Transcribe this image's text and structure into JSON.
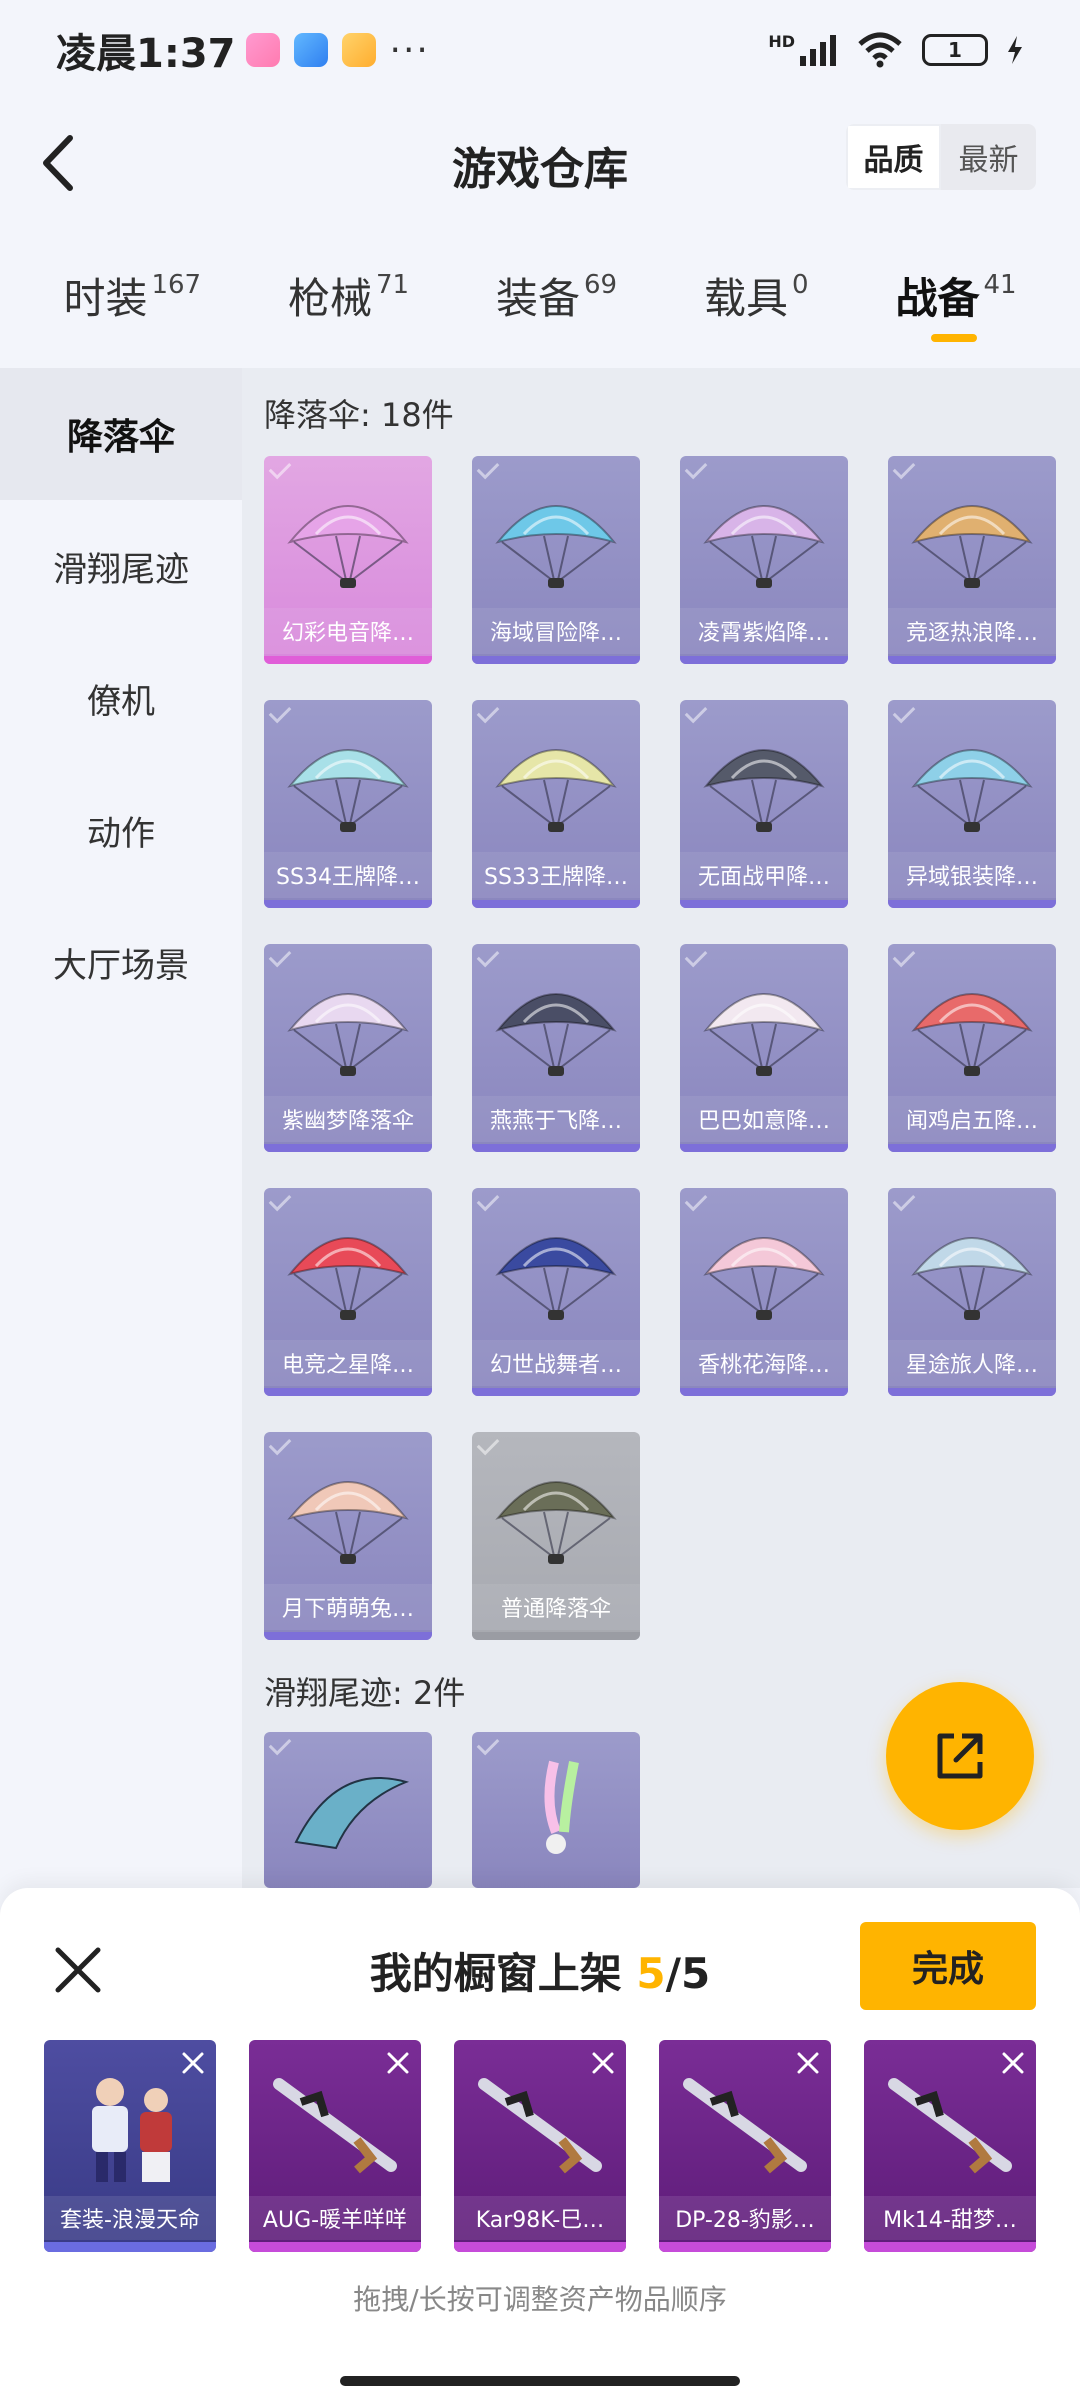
{
  "status": {
    "time": "凌晨1:37",
    "hd": "HD",
    "battery": "1"
  },
  "header": {
    "title": "游戏仓库",
    "sort_options": [
      "品质",
      "最新"
    ]
  },
  "tabs": [
    {
      "label": "时装",
      "count": "167"
    },
    {
      "label": "枪械",
      "count": "71"
    },
    {
      "label": "装备",
      "count": "69"
    },
    {
      "label": "载具",
      "count": "0"
    },
    {
      "label": "战备",
      "count": "41"
    }
  ],
  "sidebar": {
    "items": [
      "降落伞",
      "滑翔尾迹",
      "僚机",
      "动作",
      "大厅场景"
    ]
  },
  "sections": {
    "parachute": {
      "title": "降落伞: 18件"
    },
    "trail": {
      "title": "滑翔尾迹: 2件"
    }
  },
  "items": [
    {
      "name": "幻彩电音降…",
      "color": "#e6a4e8"
    },
    {
      "name": "海域冒险降…",
      "color": "#6ec8e8"
    },
    {
      "name": "凌霄紫焰降…",
      "color": "#d8b4e8"
    },
    {
      "name": "竞逐热浪降…",
      "color": "#e0b070"
    },
    {
      "name": "SS34王牌降…",
      "color": "#a8e0e8"
    },
    {
      "name": "SS33王牌降…",
      "color": "#e6e6a8"
    },
    {
      "name": "无面战甲降…",
      "color": "#555a6a"
    },
    {
      "name": "异域银装降…",
      "color": "#8ed0e8"
    },
    {
      "name": "紫幽梦降落伞",
      "color": "#e8d8f0"
    },
    {
      "name": "燕燕于飞降…",
      "color": "#4a4e66"
    },
    {
      "name": "巴巴如意降…",
      "color": "#f2e8f0"
    },
    {
      "name": "闻鸡启五降…",
      "color": "#e86a6a"
    },
    {
      "name": "电竞之星降…",
      "color": "#e84a58"
    },
    {
      "name": "幻世战舞者…",
      "color": "#3a4aa0"
    },
    {
      "name": "香桃花海降…",
      "color": "#f4c8d8"
    },
    {
      "name": "星途旅人降…",
      "color": "#c0d8e8"
    },
    {
      "name": "月下萌萌兔…",
      "color": "#f0c8b8"
    },
    {
      "name": "普通降落伞",
      "color": "#6a6e58"
    }
  ],
  "trail_items": [
    {
      "color": "#6ab0c8"
    },
    {
      "color": "#f0f0f0"
    }
  ],
  "showcase": {
    "title": "我的橱窗上架",
    "current": "5",
    "total": "/5",
    "done": "完成",
    "hint": "拖拽/长按可调整资产物品顺序",
    "slots": [
      "套装-浪漫天命",
      "AUG-暖羊咩咩",
      "Kar98K-巳…",
      "DP-28-豹影…",
      "Mk14-甜梦…"
    ]
  },
  "colors": {
    "accent": "#ffb400",
    "legendary_pink": "#d889dc",
    "epic_purple": "#8a86be"
  }
}
